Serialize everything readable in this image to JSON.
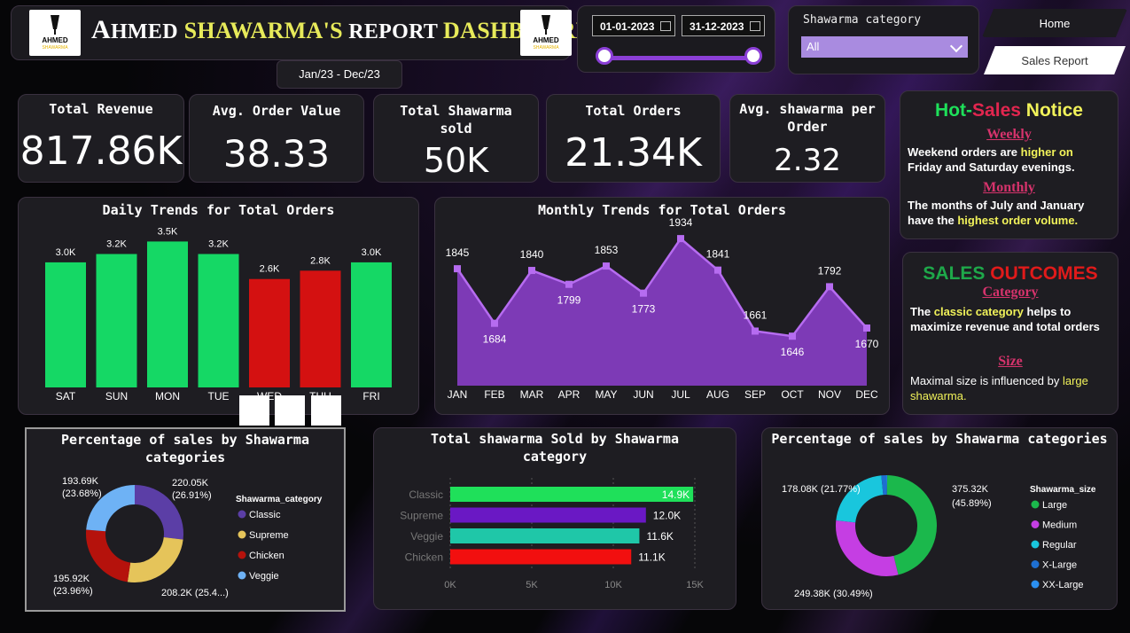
{
  "header": {
    "title_first": "A",
    "title_word": "HMED",
    "title_rest": " SHAWARMA'S",
    "title_report": " REPORT ",
    "title_dash": "DASHBOARD",
    "logo_text": "AHMED",
    "logo_subtext": "SHAWARMA"
  },
  "period_label": "Jan/23 - Dec/23",
  "date_slicer": {
    "start": "01-01-2023",
    "end": "31-12-2023"
  },
  "category_slicer": {
    "label": "Shawarma category",
    "selected": "All"
  },
  "nav": {
    "home": "Home",
    "sales_report": "Sales Report"
  },
  "kpis": [
    {
      "label": "Total Revenue",
      "value": "817.86K"
    },
    {
      "label": "Avg. Order Value",
      "value": "38.33"
    },
    {
      "label": "Total Shawarma sold",
      "value": "50K"
    },
    {
      "label": "Total Orders",
      "value": "21.34K"
    },
    {
      "label": "Avg. shawarma per Order",
      "value": "2.32"
    }
  ],
  "notice": {
    "title_hot": "Hot",
    "title_dash": "-",
    "title_sales": "Sales",
    "title_notice": " Notice",
    "weekly_label": "Weekly",
    "weekly_text_a": "Weekend orders are ",
    "weekly_hl": "higher on",
    "weekly_text_b": "Friday and Saturday evenings.",
    "monthly_label": "Monthly",
    "monthly_text_a": "The months of July and January have the ",
    "monthly_hl": "highest order volume."
  },
  "outcomes": {
    "title_sales": "SALES ",
    "title_outcomes": "OUTCOMES",
    "category_label": "Category",
    "category_text_a": "The ",
    "category_hl": "classic category",
    "category_text_b": " helps to maximize revenue and total orders",
    "size_label": "Size",
    "size_text_a": "Maximal size is influenced by ",
    "size_hl": "large",
    "size_text_b": "shawarma."
  },
  "colors": {
    "green": "#15d865",
    "red": "#d41111",
    "purple": "#8e3fd0",
    "classic": "#5b3ea6",
    "supreme": "#e5c45a",
    "chicken": "#b5120c",
    "veggie": "#6eb2f5",
    "large": "#1bb84c",
    "medium": "#c53ee3",
    "regular": "#19c6dd"
  },
  "chart_data": [
    {
      "type": "bar",
      "title": "Daily Trends for Total Orders",
      "categories": [
        "SAT",
        "SUN",
        "MON",
        "TUE",
        "WED",
        "THU",
        "FRI"
      ],
      "values": [
        3.0,
        3.2,
        3.5,
        3.2,
        2.6,
        2.8,
        3.0
      ],
      "value_labels": [
        "3.0K",
        "3.2K",
        "3.5K",
        "3.2K",
        "2.6K",
        "2.8K",
        "3.0K"
      ],
      "highlight": [
        "green",
        "green",
        "green",
        "green",
        "red",
        "red",
        "green"
      ],
      "ylim": [
        0,
        3.7
      ]
    },
    {
      "type": "area",
      "title": "Monthly Trends for Total Orders",
      "categories": [
        "JAN",
        "FEB",
        "MAR",
        "APR",
        "MAY",
        "JUN",
        "JUL",
        "AUG",
        "SEP",
        "OCT",
        "NOV",
        "DEC"
      ],
      "values": [
        1845,
        1684,
        1840,
        1799,
        1853,
        1773,
        1934,
        1841,
        1661,
        1646,
        1792,
        1670
      ],
      "ylim": [
        1500,
        1950
      ]
    },
    {
      "type": "pie",
      "title": "Percentage of sales by Shawarma categories",
      "legend_title": "Shawarma_category",
      "slices": [
        {
          "name": "Classic",
          "value": 220.05,
          "label": "220.05K",
          "pct": "(26.91%)",
          "color": "#5b3ea6"
        },
        {
          "name": "Supreme",
          "value": 208.2,
          "label": "208.2K (25.4...)",
          "pct": "",
          "color": "#e5c45a"
        },
        {
          "name": "Chicken",
          "value": 195.92,
          "label": "195.92K",
          "pct": "(23.96%)",
          "color": "#b5120c"
        },
        {
          "name": "Veggie",
          "value": 193.69,
          "label": "193.69K",
          "pct": "(23.68%)",
          "color": "#6eb2f5"
        }
      ]
    },
    {
      "type": "bar",
      "orientation": "horizontal",
      "title": "Total shawarma Sold by Shawarma category",
      "categories": [
        "Classic",
        "Supreme",
        "Veggie",
        "Chicken"
      ],
      "values": [
        14.9,
        12.0,
        11.6,
        11.1
      ],
      "value_labels": [
        "14.9K",
        "12.0K",
        "11.6K",
        "11.1K"
      ],
      "colors": [
        "#1fe05a",
        "#6a18c4",
        "#1fc7a8",
        "#f20f0f"
      ],
      "xticks": [
        "0K",
        "5K",
        "10K",
        "15K"
      ],
      "xlim": [
        0,
        15
      ]
    },
    {
      "type": "pie",
      "title": "Percentage of sales by Shawarma categories",
      "legend_title": "Shawarma_size",
      "slices": [
        {
          "name": "Large",
          "value": 375.32,
          "label": "375.32K",
          "pct": "(45.89%)",
          "color": "#1bb84c"
        },
        {
          "name": "Medium",
          "value": 249.38,
          "label": "249.38K (30.49%)",
          "pct": "",
          "color": "#c53ee3"
        },
        {
          "name": "Regular",
          "value": 178.08,
          "label": "178.08K (21.77%)",
          "pct": "",
          "color": "#19c6dd"
        },
        {
          "name": "X-Large",
          "value": 14.0,
          "label": "",
          "pct": "",
          "color": "#1e6fd1"
        },
        {
          "name": "XX-Large",
          "value": 1.5,
          "label": "",
          "pct": "",
          "color": "#2b8ff0"
        }
      ]
    }
  ]
}
